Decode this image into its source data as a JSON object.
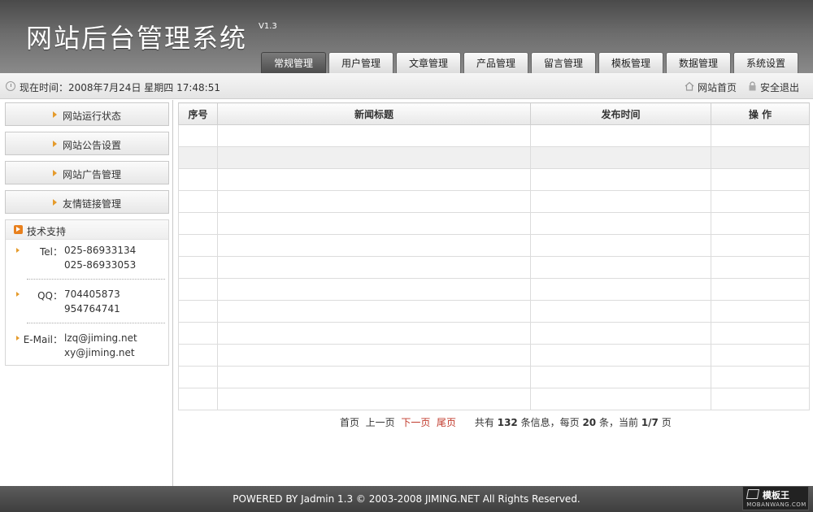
{
  "header": {
    "title": "网站后台管理系统",
    "version": "V1.3",
    "tabs": [
      {
        "label": "常规管理"
      },
      {
        "label": "用户管理"
      },
      {
        "label": "文章管理"
      },
      {
        "label": "产品管理"
      },
      {
        "label": "留言管理"
      },
      {
        "label": "模板管理"
      },
      {
        "label": "数据管理"
      },
      {
        "label": "系统设置"
      }
    ],
    "active_tab": 0
  },
  "statusbar": {
    "now": "现在时间：2008年7月24日 星期四 17:48:51",
    "home_link": "网站首页",
    "logout_link": "安全退出"
  },
  "sidebar": {
    "items": [
      {
        "label": "网站运行状态"
      },
      {
        "label": "网站公告设置"
      },
      {
        "label": "网站广告管理"
      },
      {
        "label": "友情链接管理"
      }
    ],
    "support": {
      "title": "技术支持",
      "tel_label": "Tel：",
      "tel": [
        "025-86933134",
        "025-86933053"
      ],
      "qq_label": "QQ：",
      "qq": [
        "704405873",
        "954764741"
      ],
      "email_label": "E-Mail：",
      "email": [
        "lzq@jiming.net",
        "xy@jiming.net"
      ]
    }
  },
  "table": {
    "columns": [
      "序号",
      "新闻标题",
      "发布时间",
      "操 作"
    ],
    "row_count": 13
  },
  "pager": {
    "first": "首页",
    "prev": "上一页",
    "next": "下一页",
    "last": "尾页",
    "total_prefix": "共有",
    "total": "132",
    "total_suffix": "条信息，每页",
    "per_page": "20",
    "per_page_suffix": "条，当前",
    "current": "1/7",
    "page_suffix": "页"
  },
  "footer": {
    "text": "POWERED BY Jadmin 1.3 © 2003-2008 JIMING.NET All Rights Reserved."
  },
  "watermark": {
    "name": "模板王",
    "url": "MOBANWANG.COM"
  },
  "colors": {
    "accent_orange": "#e59b2c",
    "pager_link_red": "#c0392b",
    "header_dark": "#4a4a4a"
  }
}
